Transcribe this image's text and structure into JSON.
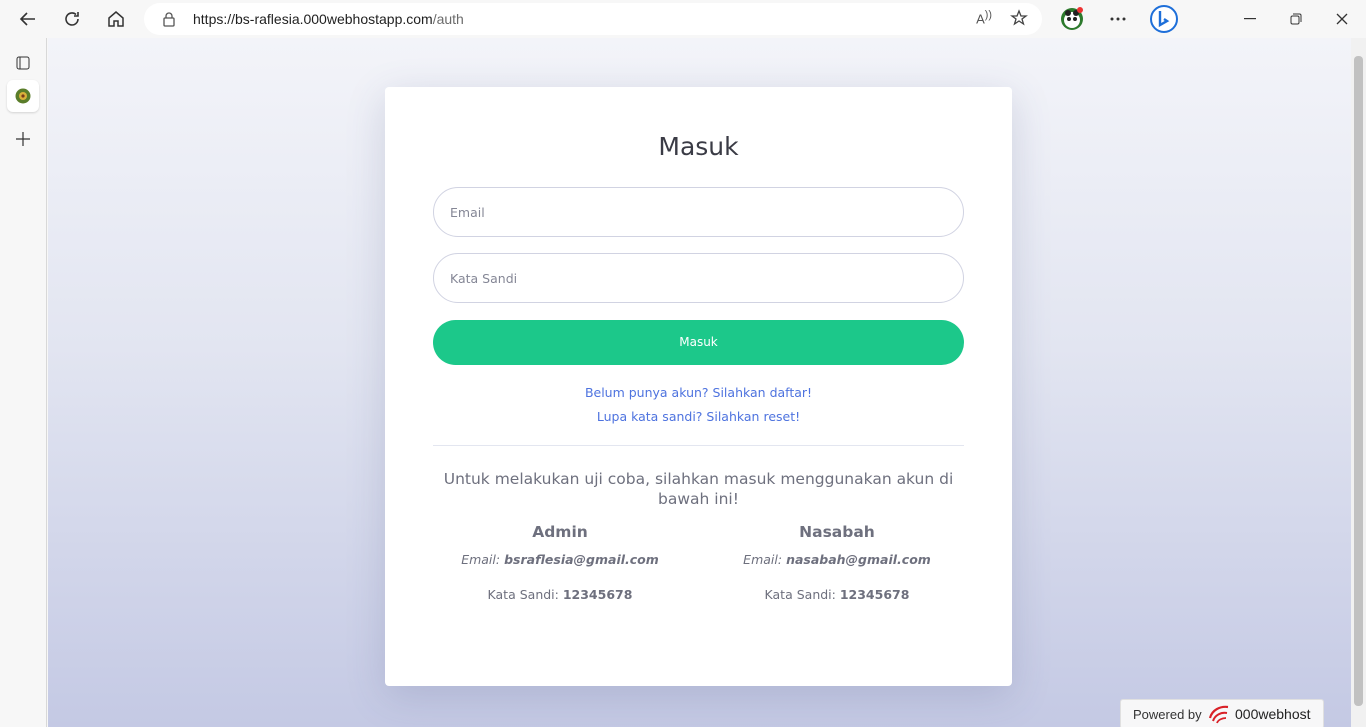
{
  "browser": {
    "url_host": "https://bs-raflesia.000webhostapp.com",
    "url_path": "/auth",
    "read_aloud_label": "A"
  },
  "page": {
    "title": "Masuk",
    "email_placeholder": "Email",
    "password_placeholder": "Kata Sandi",
    "submit_label": "Masuk",
    "register_link": "Belum punya akun? Silahkan daftar!",
    "reset_link": "Lupa kata sandi? Silahkan reset!",
    "info_text": "Untuk melakukan uji coba, silahkan masuk menggunakan akun di bawah ini!",
    "accounts": [
      {
        "role": "Admin",
        "email_label": "Email:",
        "email": "bsraflesia@gmail.com",
        "password_label": "Kata Sandi:",
        "password": "12345678"
      },
      {
        "role": "Nasabah",
        "email_label": "Email:",
        "email": "nasabah@gmail.com",
        "password_label": "Kata Sandi:",
        "password": "12345678"
      }
    ]
  },
  "footer_badge": {
    "powered_by": "Powered by",
    "brand": "000webhost"
  },
  "colors": {
    "primary_button": "#1cc88a",
    "link": "#4e73df",
    "text": "#6e707e"
  }
}
